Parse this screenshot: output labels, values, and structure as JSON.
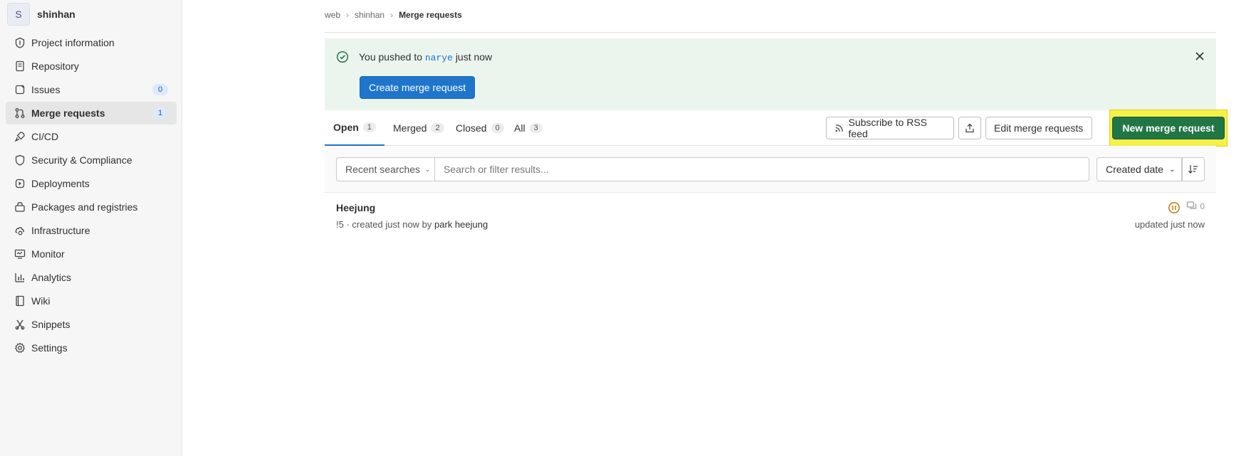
{
  "project": {
    "avatar_letter": "S",
    "name": "shinhan"
  },
  "sidebar": {
    "items": [
      {
        "label": "Project information",
        "icon": "info-icon"
      },
      {
        "label": "Repository",
        "icon": "doc-icon"
      },
      {
        "label": "Issues",
        "icon": "issues-icon",
        "count": "0"
      },
      {
        "label": "Merge requests",
        "icon": "merge-request-icon",
        "count": "1",
        "active": true
      },
      {
        "label": "CI/CD",
        "icon": "rocket-icon"
      },
      {
        "label": "Security & Compliance",
        "icon": "shield-icon"
      },
      {
        "label": "Deployments",
        "icon": "deployments-icon"
      },
      {
        "label": "Packages and registries",
        "icon": "package-icon"
      },
      {
        "label": "Infrastructure",
        "icon": "cloud-gear-icon"
      },
      {
        "label": "Monitor",
        "icon": "monitor-icon"
      },
      {
        "label": "Analytics",
        "icon": "chart-icon"
      },
      {
        "label": "Wiki",
        "icon": "book-icon"
      },
      {
        "label": "Snippets",
        "icon": "snippet-icon"
      },
      {
        "label": "Settings",
        "icon": "gear-icon"
      }
    ]
  },
  "breadcrumb": {
    "items": [
      "web",
      "shinhan"
    ],
    "current": "Merge requests"
  },
  "alert": {
    "prefix": "You pushed to",
    "branch": "narye",
    "suffix": "just now",
    "button": "Create merge request"
  },
  "tabs": [
    {
      "label": "Open",
      "count": "1"
    },
    {
      "label": "Merged",
      "count": "2"
    },
    {
      "label": "Closed",
      "count": "0"
    },
    {
      "label": "All",
      "count": "3"
    }
  ],
  "actions": {
    "rss": "Subscribe to RSS feed",
    "edit": "Edit merge requests",
    "new": "New merge request"
  },
  "filter": {
    "recent": "Recent searches",
    "placeholder": "Search or filter results...",
    "sort": "Created date"
  },
  "merge_requests": [
    {
      "title": "Heejung",
      "meta_prefix": "!5 · created just now by",
      "author": "park heejung",
      "comments": "0",
      "updated": "updated just now"
    }
  ],
  "colors": {
    "accent": "#1f75cb",
    "new_button": "#217645",
    "alert_bg": "#ecf4ee",
    "highlight": "#f5f04a"
  }
}
